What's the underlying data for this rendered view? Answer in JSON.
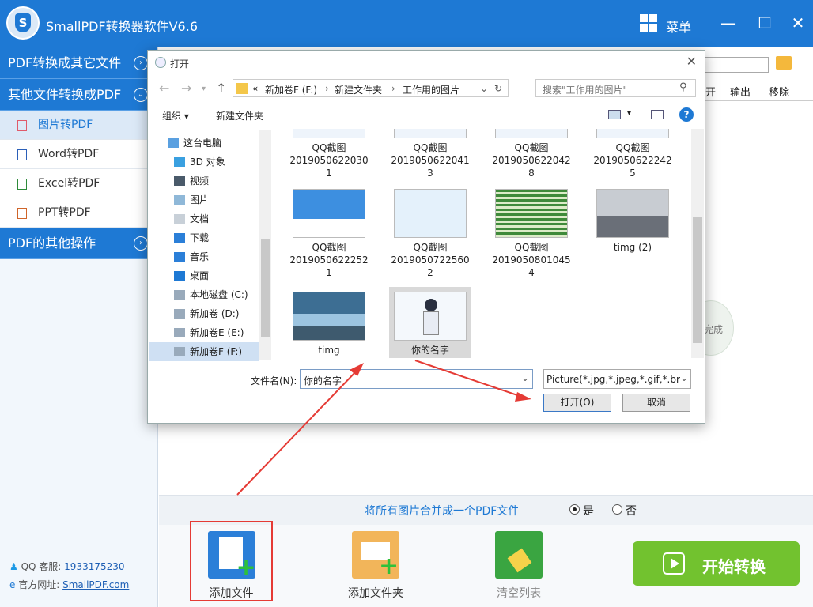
{
  "app": {
    "title": "SmallPDF转换器软件V6.6",
    "menu_label": "菜单"
  },
  "sidebar": {
    "cat1": "PDF转换成其它文件",
    "cat2": "其他文件转换成PDF",
    "items": [
      {
        "label": "图片转PDF"
      },
      {
        "label": "Word转PDF"
      },
      {
        "label": "Excel转PDF"
      },
      {
        "label": "PPT转PDF"
      }
    ],
    "cat3": "PDF的其他操作",
    "qq_label": "QQ 客服:",
    "qq_value": "1933175230",
    "site_label": "官方网址:",
    "site_value": "SmallPDF.com"
  },
  "main": {
    "col_open": "开",
    "col_output": "输出",
    "col_remove": "移除",
    "done_text": "完成",
    "merge_text": "将所有图片合并成一个PDF文件",
    "yes": "是",
    "no": "否"
  },
  "bottom": {
    "add_file": "添加文件",
    "add_folder": "添加文件夹",
    "clear_list": "清空列表",
    "start": "开始转换"
  },
  "dialog": {
    "title": "打开",
    "addr_prefix": "«",
    "addr_drive": "新加卷F (F:)",
    "addr_folder": "新建文件夹",
    "addr_current": "工作用的图片",
    "search_placeholder": "搜索\"工作用的图片\"",
    "organize": "组织 ▾",
    "new_folder": "新建文件夹",
    "tree": [
      "这台电脑",
      "3D 对象",
      "视频",
      "图片",
      "文档",
      "下载",
      "音乐",
      "桌面",
      "本地磁盘 (C:)",
      "新加卷 (D:)",
      "新加卷E (E:)",
      "新加卷F (F:)"
    ],
    "files": [
      {
        "name1": "QQ截图",
        "name2": "2019050622030",
        "name3": "1"
      },
      {
        "name1": "QQ截图",
        "name2": "2019050622041",
        "name3": "3"
      },
      {
        "name1": "QQ截图",
        "name2": "2019050622042",
        "name3": "8"
      },
      {
        "name1": "QQ截图",
        "name2": "2019050622242",
        "name3": "5"
      },
      {
        "name1": "QQ截图",
        "name2": "2019050622252",
        "name3": "1"
      },
      {
        "name1": "QQ截图",
        "name2": "2019050722560",
        "name3": "2"
      },
      {
        "name1": "QQ截图",
        "name2": "2019050801045",
        "name3": "4"
      },
      {
        "name1": "timg (2)"
      },
      {
        "name1": "timg"
      },
      {
        "name1": "你的名字"
      }
    ],
    "filename_label": "文件名(N):",
    "filename_value": "你的名字",
    "filter": "Picture(*.jpg,*.jpeg,*.gif,*.bm",
    "open_btn": "打开(O)",
    "cancel_btn": "取消"
  },
  "colors": {
    "brand": "#1e79d4",
    "start": "#72c22f",
    "annotation": "#e53b35"
  }
}
